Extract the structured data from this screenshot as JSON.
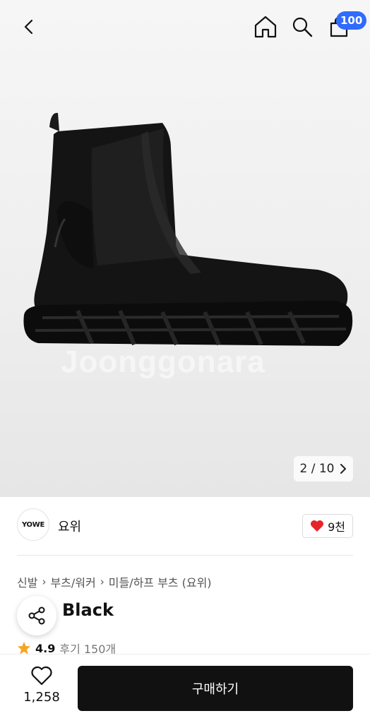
{
  "header": {
    "cart_badge": "100",
    "icons": [
      "back-icon",
      "home-icon",
      "search-icon",
      "cart-icon"
    ]
  },
  "image": {
    "watermark": "Joonggonara",
    "pager": "2 / 10"
  },
  "seller": {
    "logo_text": "YOWE",
    "name": "요위",
    "likes": "9천"
  },
  "breadcrumb": [
    "신발",
    "부츠/워커",
    "미들/하프 부츠 (요위)"
  ],
  "product": {
    "title": "Black",
    "rating": "4.9",
    "reviews": "후기 150개"
  },
  "bottom": {
    "wish_count": "1,258",
    "buy_label": "구매하기"
  },
  "colors": {
    "accent_badge": "#2f6bff",
    "buy_button": "#111111",
    "heart": "#e5252a",
    "star": "#f5a623"
  }
}
